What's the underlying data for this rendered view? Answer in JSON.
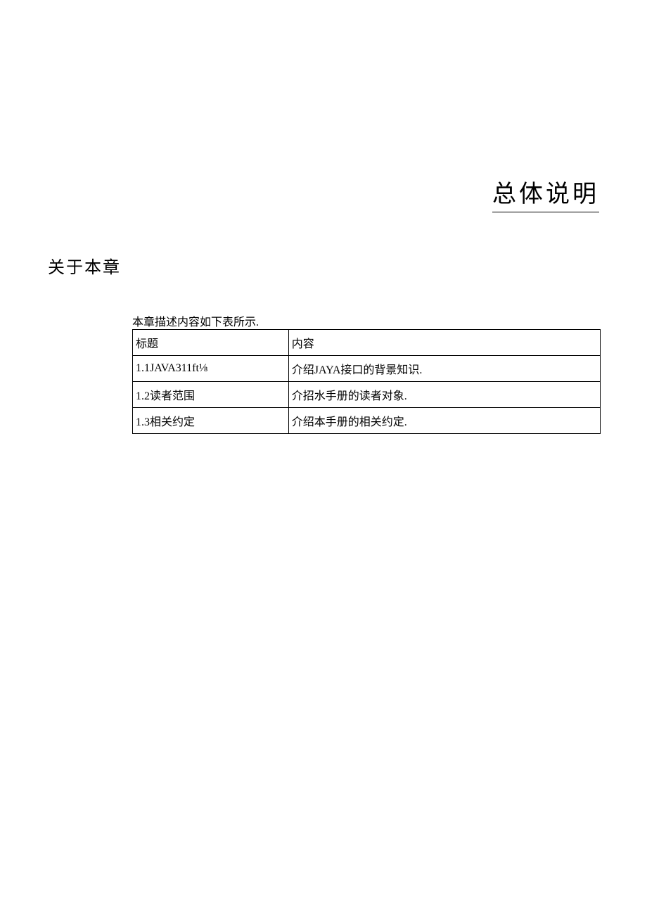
{
  "title": "总体说明",
  "section_heading": "关于本章",
  "caption": "本章描述内容如下表所示.",
  "table": {
    "headers": {
      "col1": "标题",
      "col2": "内容"
    },
    "rows": [
      {
        "col1": "1.1JAVA311ft⅛",
        "col2": "介绍JAYA接口的背景知识."
      },
      {
        "col1": "1.2读者范围",
        "col2": "介招水手册的读者对象."
      },
      {
        "col1": "1.3相关约定",
        "col2": "介绍本手册的相关约定."
      }
    ]
  }
}
